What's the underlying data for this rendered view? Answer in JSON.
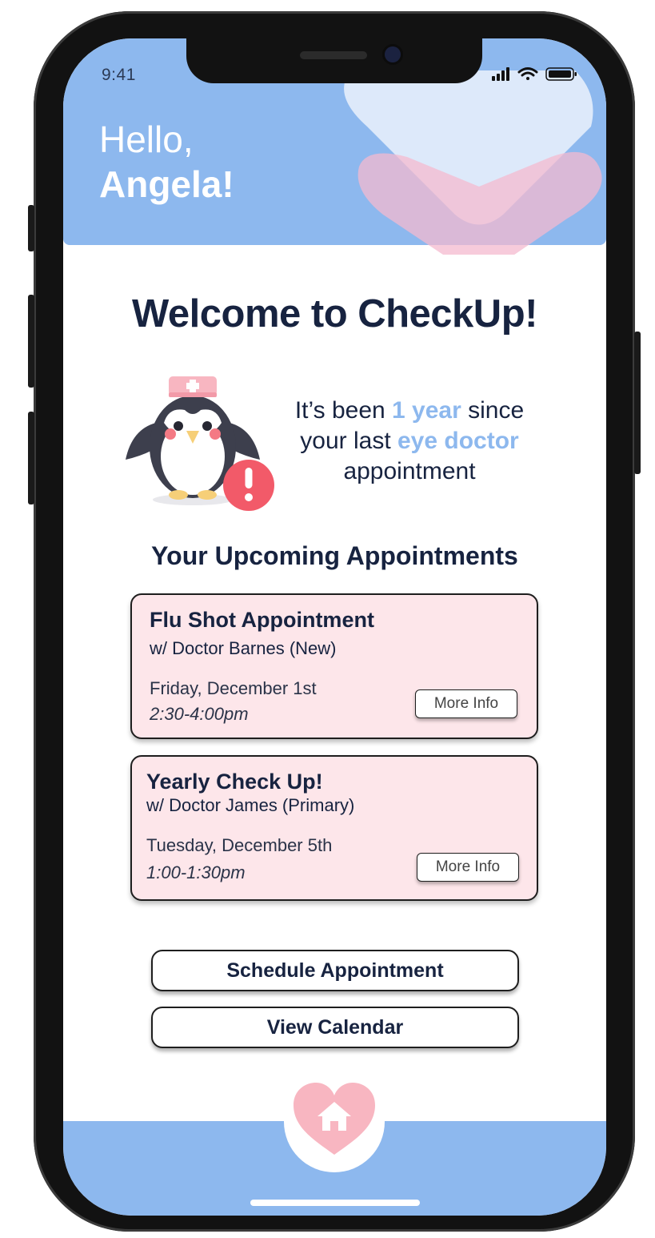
{
  "status_bar": {
    "time": "9:41"
  },
  "header": {
    "greeting_line1": "Hello,",
    "greeting_line2": "Angela!"
  },
  "welcome": {
    "title": "Welcome to CheckUp!"
  },
  "reminder": {
    "text_1": "It’s been ",
    "highlight_1": "1 year",
    "text_2": " since your last ",
    "highlight_2": "eye doctor",
    "text_3": " appointment"
  },
  "appointments": {
    "section_title": "Your Upcoming Appointments",
    "items": [
      {
        "title": "Flu Shot Appointment",
        "doctor": "w/ Doctor Barnes (New)",
        "date": "Friday, December 1st",
        "time": "2:30-4:00pm",
        "button_label": "More Info"
      },
      {
        "title": "Yearly Check Up!",
        "doctor": "w/ Doctor James (Primary)",
        "date": "Tuesday, December 5th",
        "time": "1:00-1:30pm",
        "button_label": "More Info"
      }
    ]
  },
  "actions": {
    "schedule_label": "Schedule Appointment",
    "calendar_label": "View Calendar"
  },
  "icons": {
    "home": "home-icon",
    "penguin": "nurse-penguin-icon",
    "alert": "exclamation-icon",
    "signal": "signal-icon",
    "wifi": "wifi-icon",
    "battery": "battery-icon"
  },
  "colors": {
    "brand_blue": "#8db8ee",
    "card_pink": "#fde6ea",
    "heart_pink": "#f8b6c1",
    "alert_red": "#f25a69",
    "text_dark": "#172340"
  }
}
